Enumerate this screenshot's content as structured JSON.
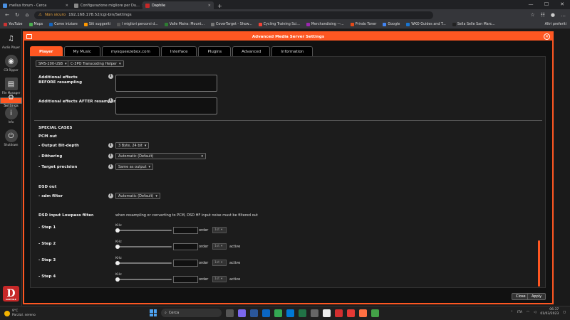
{
  "browser": {
    "tabs": [
      {
        "label": "melius forum - Cerca"
      },
      {
        "label": "Configurazione migliore per Du..."
      },
      {
        "label": "Daphile"
      }
    ],
    "new_tab": "+",
    "url_warning": "Non sicuro",
    "url": "192.168.178.52/cgi-bin/Settings",
    "bookmarks": [
      "YouTube",
      "Maps",
      "Come iniziare",
      "Siti suggeriti",
      "I migliori percorsi d...",
      "Valle Maira: Mount...",
      "CoverTarget - Show...",
      "Cycling Training Sci...",
      "Merchandising —...",
      "Prindo Toner",
      "Google",
      "WKO Guides and T...",
      "Sella Selle San Marc..."
    ],
    "bookmarks_other": "Altri preferiti"
  },
  "sidebar": {
    "items": [
      {
        "label": "Audio Player"
      },
      {
        "label": "CD Ripper"
      },
      {
        "label": "File Manager"
      },
      {
        "label": "Settings"
      },
      {
        "label": "Info"
      },
      {
        "label": "Shutdown"
      }
    ],
    "logo_letter": "D",
    "logo_text": "DAPHILE"
  },
  "dialog": {
    "title": "Advanced Media Server Settings",
    "tabs": [
      "Player",
      "My Music",
      "mysqueezebox.com",
      "Interface",
      "Plugins",
      "Advanced",
      "Information"
    ],
    "player_select": "SMS-200-USB",
    "helper_select": "C-3PO Transcoding Helper",
    "effects_before": "Additional effects BEFORE resampling",
    "effects_after": "Additional effects AFTER resampling",
    "special_cases": "SPECIAL CASES",
    "pcm_out": "PCM out",
    "bit_depth_label": "- Output Bit-depth",
    "bit_depth_value": "3 Byte, 24 bit",
    "dithering_label": "- Dithering",
    "dithering_value": "Automatic (Default)",
    "precision_label": "- Target precision",
    "precision_value": "Same as output",
    "dsd_out": "DSD out",
    "sdm_label": "- sdm filter",
    "sdm_value": "Automatic (Default)",
    "lowpass_label": "DSD input Lowpass filter.",
    "lowpass_note": "when resampling or converting to PCM, DSD HF input noise must be filtered out",
    "steps": [
      {
        "label": "- Step 1",
        "unit": "KHz",
        "order": "order",
        "order_value": "1st",
        "active": ""
      },
      {
        "label": "- Step 2",
        "unit": "KHz",
        "order": "order",
        "order_value": "1st",
        "active": "active"
      },
      {
        "label": "- Step 3",
        "unit": "KHz",
        "order": "order",
        "order_value": "1st",
        "active": "active"
      },
      {
        "label": "- Step 4",
        "unit": "KHz",
        "order": "order",
        "order_value": "1st",
        "active": "active"
      }
    ],
    "close_button": "Close",
    "apply_button": "Apply"
  },
  "taskbar": {
    "temperature": "9°C",
    "weather": "Parzial. sereno",
    "search": "Cerca",
    "lang": "ITA",
    "time": "06:37",
    "date": "01/03/2023"
  },
  "colors": {
    "accent": "#ff5722",
    "danger": "#c62828"
  }
}
